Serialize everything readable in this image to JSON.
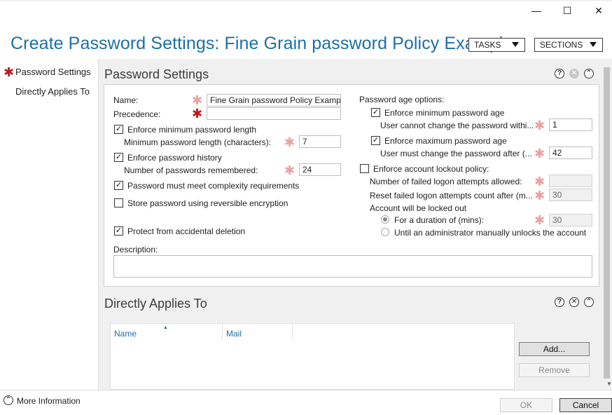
{
  "window": {
    "minimize_icon": "minimize-icon",
    "maximize_icon": "maximize-icon",
    "close_icon": "close-icon"
  },
  "title": "Create Password Settings: Fine Grain password Policy Example",
  "header_buttons": {
    "tasks": "TASKS",
    "sections": "SECTIONS"
  },
  "nav": {
    "items": [
      "Password Settings",
      "Directly Applies To"
    ]
  },
  "password_settings": {
    "title": "Password Settings",
    "name_label": "Name:",
    "name_value": "Fine Grain password Policy Example",
    "precedence_label": "Precedence:",
    "precedence_value": "",
    "enforce_min_length": "Enforce minimum password length",
    "enforce_min_length_checked": true,
    "min_length_label": "Minimum password length (characters):",
    "min_length_value": "7",
    "enforce_history": "Enforce password history",
    "enforce_history_checked": true,
    "history_label": "Number of passwords remembered:",
    "history_value": "24",
    "complexity": "Password must meet complexity requirements",
    "complexity_checked": true,
    "reversible": "Store password using reversible encryption",
    "reversible_checked": false,
    "protect": "Protect from accidental deletion",
    "protect_checked": true,
    "description_label": "Description:",
    "age_options_label": "Password age options:",
    "enforce_min_age": "Enforce minimum password age",
    "enforce_min_age_checked": true,
    "min_age_label": "User cannot change the password withi...",
    "min_age_value": "1",
    "enforce_max_age": "Enforce maximum password age",
    "enforce_max_age_checked": true,
    "max_age_label": "User must change the password after (...",
    "max_age_value": "42",
    "lockout_policy": "Enforce account lockout policy:",
    "lockout_policy_checked": false,
    "failed_attempts_label": "Number of failed logon attempts allowed:",
    "failed_attempts_value": "",
    "reset_label": "Reset failed logon attempts count after (m...",
    "reset_value": "30",
    "locked_out_label": "Account will be locked out",
    "duration_label": "For a duration of (mins):",
    "duration_value": "30",
    "manual_unlock_label": "Until an administrator manually unlocks the account"
  },
  "directly_applies": {
    "title": "Directly Applies To",
    "columns": [
      "Name",
      "Mail"
    ],
    "add_button": "Add...",
    "remove_button": "Remove"
  },
  "footer": {
    "more_info": "More Information",
    "ok": "OK",
    "cancel": "Cancel"
  },
  "colors": {
    "accent": "#1d6fa5",
    "required_star": "#c0151b",
    "required_star_pink": "#e8a1a1"
  }
}
